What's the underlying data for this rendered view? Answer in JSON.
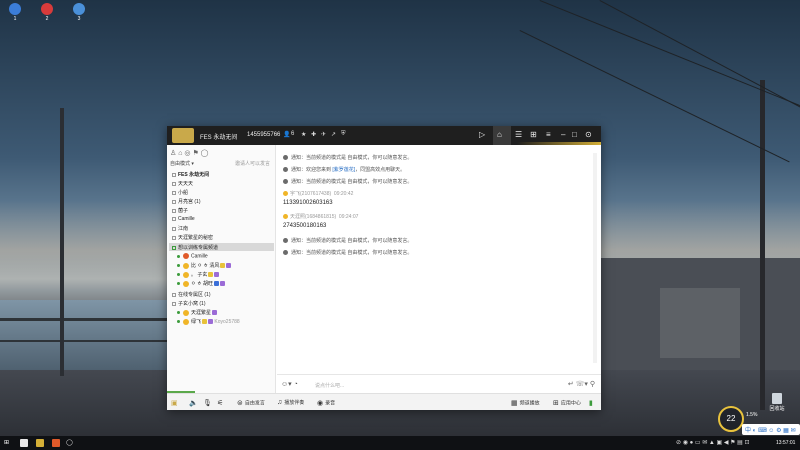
{
  "desktop": {
    "icons": [
      {
        "label": "1",
        "icon": "search-icon",
        "color": "#3b7dd8"
      },
      {
        "label": "2",
        "icon": "forbidden-icon",
        "color": "#d83b3b"
      },
      {
        "label": "3",
        "icon": "y-icon",
        "color": "#4a90d9"
      }
    ],
    "recycle_label": "回收站",
    "gauge_value": "22",
    "gauge_sub": "1.5%"
  },
  "window": {
    "channel_name": "FES 永劫无间",
    "channel_id": "1455955766",
    "online_count": "6",
    "accent_color": "#d4af37"
  },
  "left": {
    "mode_label": "自由模式 ▾",
    "mode_right": "邀请人可以发言",
    "channels": [
      "FES 永劫无间",
      "天天天",
      "小船",
      "月亮宫 (1)",
      "菌子",
      "Camille",
      "江南",
      "天涯繁星的秘密"
    ],
    "selected_channel": "想以训练专属频道",
    "members": [
      {
        "name": "Camille",
        "color": "#e05a2a"
      },
      {
        "name": "比 ㅇ ㅎ 清风",
        "color": "#f0b528"
      },
      {
        "name": "。 子玄",
        "color": "#f0b528"
      },
      {
        "name": "ㅇ ㅎ 胡旺",
        "color": "#f0b528"
      }
    ],
    "group2": "在线专属区 (1)",
    "group3": "子玄小窝 (1)",
    "sub_members": [
      {
        "name": "天涯繁星",
        "color": "#f0b528"
      },
      {
        "name": "绿飞",
        "color": "#f0b528",
        "extra": "Koyo25788"
      }
    ]
  },
  "chat": {
    "messages": [
      {
        "text": "通知：当前频道的模式是 自由模式，你可以随意发言。"
      },
      {
        "text_a": "通知：欢迎您来到 ",
        "link": "[紫罗莲花]",
        "text_b": "，同盟高效点用聊天。"
      },
      {
        "text": "通知：当前频道的模式是 自由模式，你可以随意发言。"
      }
    ],
    "post1": {
      "nick": "宇飞(2107617438)",
      "time": "09:20:42",
      "content": "113391002603163"
    },
    "post2": {
      "nick": "天涯照(1684861815)",
      "time": "09:24:07",
      "content": "274350018016⁠3"
    },
    "tail": "通知：当前频道的模式是 自由模式，你可以随意发言。",
    "tail2": "通知：当前频道的模式是 自由模式，你可以随意发言。"
  },
  "input": {
    "placeholder": "说点什么吧..."
  },
  "toolbar": {
    "free_speak": "自由发言",
    "music": "播放伴奏",
    "record": "录音",
    "channel_manage": "频道播放",
    "app_center": "应用中心"
  },
  "taskbar": {
    "clock": "13:57:01"
  }
}
